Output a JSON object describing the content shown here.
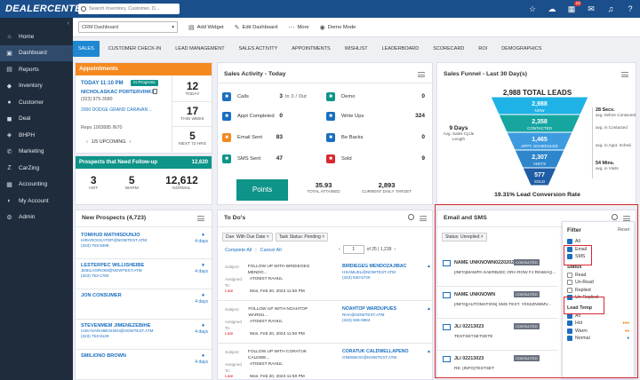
{
  "topbar": {
    "logo": "DEALERCENTER",
    "search_placeholder": "Search Inventory, Customer, D...",
    "notif_count": "10"
  },
  "sidebar": {
    "items": [
      {
        "label": "Home",
        "icon": "home-icon"
      },
      {
        "label": "Dashboard",
        "icon": "dashboard-icon"
      },
      {
        "label": "Reports",
        "icon": "reports-icon"
      },
      {
        "label": "Inventory",
        "icon": "car-icon"
      },
      {
        "label": "Customer",
        "icon": "customer-icon"
      },
      {
        "label": "Deal",
        "icon": "deal-icon"
      },
      {
        "label": "BHPH",
        "icon": "bhph-icon"
      },
      {
        "label": "Marketing",
        "icon": "marketing-icon"
      },
      {
        "label": "CarZing",
        "icon": "carzing-icon"
      },
      {
        "label": "Accounting",
        "icon": "accounting-icon"
      },
      {
        "label": "My Account",
        "icon": "account-icon"
      },
      {
        "label": "Admin",
        "icon": "admin-icon"
      }
    ]
  },
  "toolbar": {
    "dashboard_select": "CRM Dashboard",
    "add_widget": "Add Widget",
    "edit_dashboard": "Edit Dashboard",
    "more": "More",
    "demo_mode": "Demo Mode"
  },
  "tabs": [
    "SALES",
    "CUSTOMER CHECK-IN",
    "LEAD MANAGEMENT",
    "SALES ACTIVITY",
    "APPOINTMENTS",
    "WISHLIST",
    "LEADERBOARD",
    "SCORECARD",
    "ROI",
    "DEMOGRAPHICS"
  ],
  "appointments": {
    "title": "Appointments",
    "today": "TODAY 11:10 PM",
    "status": "In Progress",
    "name": "NICHOLASKAC PORTERVIHKI",
    "phone": "(323) 975-3580",
    "vehicle": "2000 DODGE GRAND CARAVAN ...",
    "repo": "Repo 1003685 IN70",
    "upcoming": "1/5 UPCOMING",
    "stats": [
      {
        "value": "12",
        "label": "TODAY"
      },
      {
        "value": "17",
        "label": "THIS WEEK"
      },
      {
        "value": "5",
        "label": "NEXT 72 HRS"
      }
    ]
  },
  "followup": {
    "title": "Prospects that Need Follow-up",
    "total": "12,620",
    "stats": [
      {
        "value": "3",
        "label": "HOT"
      },
      {
        "value": "5",
        "label": "WARM"
      },
      {
        "value": "12,612",
        "label": "NORMAL"
      }
    ]
  },
  "sales_activity": {
    "title": "Sales Activity - Today",
    "left": [
      {
        "label": "Calls",
        "extra_in": "In",
        "in_val": "0",
        "sep": "/",
        "extra_out": "Out",
        "value": "3",
        "color": "#1a6fc0"
      },
      {
        "label": "Appt Completed",
        "value": "0",
        "color": "#1a6fc0"
      },
      {
        "label": "Email Sent",
        "value": "83",
        "color": "#f4891f"
      },
      {
        "label": "SMS Sent",
        "value": "47",
        "color": "#0e9488"
      }
    ],
    "right": [
      {
        "label": "Demo",
        "value": "0",
        "color": "#0e9488"
      },
      {
        "label": "Write Ups",
        "value": "324",
        "color": "#1a6fc0"
      },
      {
        "label": "Be Backs",
        "value": "0",
        "color": "#1a6fc0"
      },
      {
        "label": "Sold",
        "value": "9",
        "color": "#d8282f"
      }
    ],
    "points_label": "Points",
    "total_attained": "35.93",
    "total_attained_label": "TOTAL ATTAINED",
    "current_target": "2,893",
    "current_target_label": "CURRENT DAILY TARGET"
  },
  "funnel": {
    "title": "Sales Funnel - Last 30 Day(s)",
    "total": "2,988 TOTAL LEADS",
    "stages": [
      {
        "value": "2,988",
        "label": "NOW",
        "color": "#1fb2e6"
      },
      {
        "value": "2,358",
        "label": "CONTACTED",
        "color": "#17a5a0"
      },
      {
        "value": "1,465",
        "label": "APPT. SCHEDULED",
        "color": "#3d9be0"
      },
      {
        "value": "2,307",
        "label": "VISITS",
        "color": "#2d86cc"
      },
      {
        "value": "577",
        "label": "SOLD",
        "color": "#1f5da6"
      }
    ],
    "cycle_days": "9 Days",
    "cycle_label": "Avg. Sales Cycle Length",
    "right_labels": [
      {
        "bold": "28 Secs.",
        "text": "avg. before Contacted"
      },
      {
        "bold": "",
        "text": "avg. in Contacted"
      },
      {
        "bold": "",
        "text": "avg. in Appt. Sched."
      },
      {
        "bold": "54 Mins.",
        "text": "avg. in Visits"
      }
    ],
    "conversion": "19.31% Lead Conversion Rate"
  },
  "prospects": {
    "title": "New Prospects (4,723)",
    "items": [
      {
        "name": "TOMHUD MATHISDUNJO",
        "email": "HIRAROCKATOP@NOWTEST.ATM",
        "phone": "(323) 753-8499",
        "days": "4 days"
      },
      {
        "name": "LESTERPEC WILLISHEIBE",
        "email": "JEBILAGRIOM@NOWTEST.ATM",
        "phone": "(323) 753-1780",
        "days": "4 days"
      },
      {
        "name": "JON CONSUMER",
        "email": "",
        "phone": "",
        "days": "4 days"
      },
      {
        "name": "STEVENMEM JIMENEZEBIHE",
        "email": "USKAVARABEGHEN@NOWTEST.ATM",
        "phone": "(323) 753-8129",
        "days": "4 days"
      },
      {
        "name": "SMILIONO BROWN",
        "email": "",
        "phone": "",
        "days": "4 days"
      }
    ]
  },
  "todos": {
    "title": "To Do's",
    "chips": [
      "Due: With Due Date ×",
      "Task Status: Pending ×"
    ],
    "complete_all": "Complete All",
    "cancel_all": "Cancel All",
    "page": "1",
    "page_of": "of 25 | 1,239",
    "items": [
      {
        "subject_lab": "Subject:",
        "subject": "FOLLOW UP WITH BIRDIEGEG MENDO...",
        "assigned_lab": "Assigned To:",
        "assigned": "ATOMST RAHUL",
        "status": "Late",
        "date": "Mon, Feb 20, 2023 11:50 PM",
        "person": "BIRDIEGEG MENDOZAJIBAC",
        "email": "HSAMUEL@NOWTEST.ATM",
        "phone": "(323) 930-5740"
      },
      {
        "subject_lab": "Subject:",
        "subject": "FOLLOW UP WITH NOAHTOP WARDU...",
        "assigned_lab": "Assigned To:",
        "assigned": "ATOMST RAHUL",
        "status": "Late",
        "date": "Mon, Feb 20, 2023 11:50 PM",
        "person": "NOAHTOP WARDUPUES",
        "email": "RHA@NOWTEST.ATM",
        "phone": "(323) 936-6964"
      },
      {
        "subject_lab": "Subject:",
        "subject": "FOLLOW UP WITH CORATUK CALDWE...",
        "assigned_lab": "Assigned To:",
        "assigned": "ATOMST RAHUL",
        "status": "Late",
        "date": "Mon, Feb 20, 2023 11:50 PM",
        "person": "CORATUK CALDWELLAPENO",
        "email": "ONDEBOO@NOWTEST.ATM",
        "phone": ""
      }
    ]
  },
  "email_sms": {
    "title": "Email and SMS",
    "chip": "Status: Unreplied ×",
    "items": [
      {
        "name": "NAME UNKNOWN02202023",
        "badge": "CONTACTED",
        "text": "[INFO]MAWPA SAERBJEC ORA ROW FJ RINWAQ..."
      },
      {
        "name": "NAME UNKNOWN",
        "badge": "CONTACTED",
        "text": "[INFO][AUTOMATION] SMS TEXT. Y0S2ZNWMV..."
      },
      {
        "name": "JLI 02213023",
        "badge": "CONTACTED",
        "text": "TESTSETSETSETE"
      },
      {
        "name": "JLI 02213023",
        "badge": "CONTACTED",
        "text": "RE: [INFO]TESTSET"
      }
    ]
  },
  "filter": {
    "title": "Filter",
    "reset": "Reset",
    "channel": [
      {
        "label": "All",
        "checked": true
      },
      {
        "label": "Email",
        "checked": true
      },
      {
        "label": "SMS",
        "checked": true
      }
    ],
    "status_title": "Status",
    "status": [
      {
        "label": "Read",
        "checked": false
      },
      {
        "label": "Un-Read",
        "checked": false
      },
      {
        "label": "Replied",
        "checked": false
      },
      {
        "label": "Un-Replied",
        "checked": true
      }
    ],
    "temp_title": "Lead Temp",
    "temp": [
      {
        "label": "All",
        "checked": true
      },
      {
        "label": "Hot",
        "checked": true
      },
      {
        "label": "Warm",
        "checked": true
      },
      {
        "label": "Normal",
        "checked": true
      }
    ]
  }
}
